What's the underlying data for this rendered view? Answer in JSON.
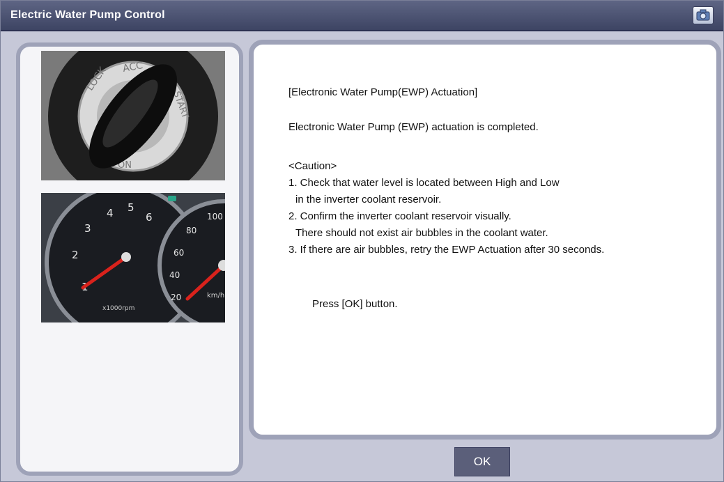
{
  "window": {
    "title": "Electric Water Pump Control",
    "camera_icon": "camera-icon"
  },
  "images": {
    "ignition": {
      "icon": "ignition-key-image",
      "labels": [
        "LOCK",
        "ACC",
        "START",
        "ON"
      ]
    },
    "tachometer": {
      "icon": "tachometer-image",
      "ticks": [
        "1",
        "2",
        "3",
        "4",
        "5",
        "6"
      ],
      "unit": "x1000rpm",
      "speed_ticks": [
        "20",
        "40",
        "60",
        "80",
        "100"
      ],
      "speed_unit": "km/h"
    }
  },
  "message": {
    "heading": "[Electronic Water Pump(EWP) Actuation]",
    "status": "Electronic Water Pump (EWP) actuation is completed.",
    "caution_title": "<Caution>",
    "item1a": "1. Check that water level is located between High and Low",
    "item1b": "in the inverter coolant reservoir.",
    "item2a": "2. Confirm the inverter coolant reservoir visually.",
    "item2b": "There should not exist air bubbles in the coolant water.",
    "item3": "3. If there are air bubbles, retry the EWP Actuation after 30 seconds.",
    "prompt": "Press [OK] button."
  },
  "buttons": {
    "ok_label": "OK"
  },
  "colors": {
    "titlebar": "#4a5070",
    "panel_border": "#9ea2b8",
    "button": "#5b5f7a"
  }
}
